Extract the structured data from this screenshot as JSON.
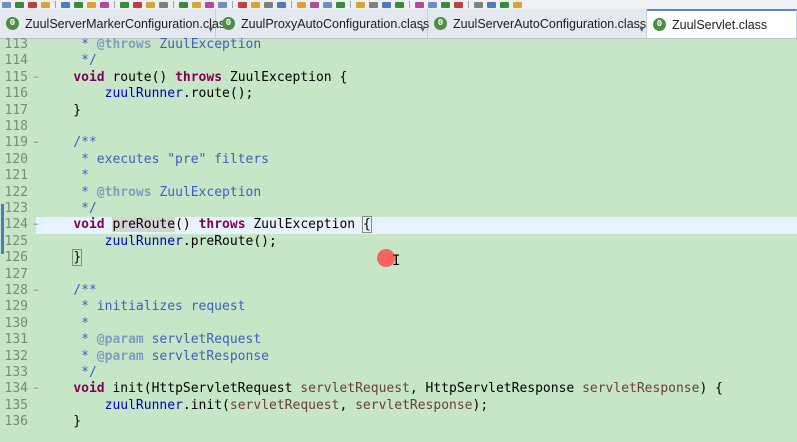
{
  "editor_tabs": [
    {
      "label": "ZuulServerMarkerConfiguration.class",
      "active": false,
      "icon": "class-file-icon"
    },
    {
      "label": "ZuulProxyAutoConfiguration.class",
      "active": false,
      "icon": "class-file-icon"
    },
    {
      "label": "ZuulServerAutoConfiguration.class",
      "active": false,
      "icon": "class-file-icon"
    },
    {
      "label": "ZuulServlet.class",
      "active": true,
      "icon": "class-file-icon"
    }
  ],
  "tab_overflow_icon": "chevron-down-icon",
  "code_lines": [
    {
      "num": "113",
      "text": "     * @throws ZuulException"
    },
    {
      "num": "114",
      "text": "     */"
    },
    {
      "num": "115",
      "text": "    void route() throws ZuulException {"
    },
    {
      "num": "116",
      "text": "        zuulRunner.route();"
    },
    {
      "num": "117",
      "text": "    }"
    },
    {
      "num": "118",
      "text": ""
    },
    {
      "num": "119",
      "text": "    /**"
    },
    {
      "num": "120",
      "text": "     * executes \"pre\" filters"
    },
    {
      "num": "121",
      "text": "     *"
    },
    {
      "num": "122",
      "text": "     * @throws ZuulException"
    },
    {
      "num": "123",
      "text": "     */"
    },
    {
      "num": "124",
      "text": "    void preRoute() throws ZuulException {"
    },
    {
      "num": "125",
      "text": "        zuulRunner.preRoute();"
    },
    {
      "num": "126",
      "text": "    }"
    },
    {
      "num": "127",
      "text": ""
    },
    {
      "num": "128",
      "text": "    /**"
    },
    {
      "num": "129",
      "text": "     * initializes request"
    },
    {
      "num": "130",
      "text": "     *"
    },
    {
      "num": "131",
      "text": "     * @param servletRequest"
    },
    {
      "num": "132",
      "text": "     * @param servletResponse"
    },
    {
      "num": "133",
      "text": "     */"
    },
    {
      "num": "134",
      "text": "    void init(HttpServletRequest servletRequest, HttpServletResponse servletResponse) {"
    },
    {
      "num": "135",
      "text": "        zuulRunner.init(servletRequest, servletResponse);"
    },
    {
      "num": "136",
      "text": "    }"
    }
  ],
  "current_line": "124",
  "fold_markers": [
    "115",
    "119",
    "124",
    "128",
    "134"
  ],
  "colors": {
    "editor_background": "#c7e6c7",
    "current_line": "#e8f2fe",
    "keyword": "#7f0055",
    "field": "#0000c0",
    "javadoc": "#3f5fbf",
    "javadoc_tag": "#7f9fbf",
    "parameter": "#6a3e3e",
    "mouse_highlight": "#ff4b4b"
  }
}
